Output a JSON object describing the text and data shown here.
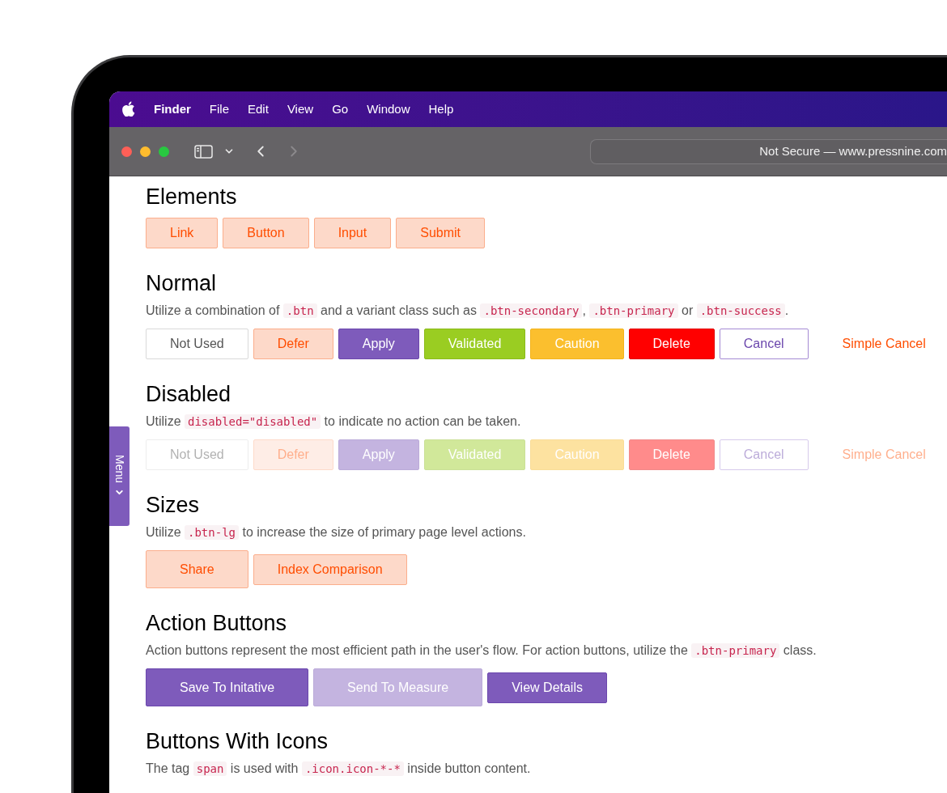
{
  "menu_bar": {
    "items": [
      {
        "label": "Finder",
        "bold": true
      },
      {
        "label": "File",
        "bold": false
      },
      {
        "label": "Edit",
        "bold": false
      },
      {
        "label": "View",
        "bold": false
      },
      {
        "label": "Go",
        "bold": false
      },
      {
        "label": "Window",
        "bold": false
      },
      {
        "label": "Help",
        "bold": false
      }
    ]
  },
  "browser": {
    "address": "Not Secure — www.pressnine.com"
  },
  "side_tab": {
    "label": "Menu"
  },
  "sections": [
    {
      "heading": "Elements",
      "buttons": [
        {
          "label": "Link",
          "kind": "secondary",
          "large": false,
          "disabled": false
        },
        {
          "label": "Button",
          "kind": "secondary",
          "large": false,
          "disabled": false
        },
        {
          "label": "Input",
          "kind": "secondary",
          "large": false,
          "disabled": false
        },
        {
          "label": "Submit",
          "kind": "secondary",
          "large": false,
          "disabled": false
        }
      ]
    },
    {
      "heading": "Normal",
      "description": [
        {
          "text": "Utilize a combination of ",
          "code": false
        },
        {
          "text": ".btn",
          "code": true
        },
        {
          "text": " and a variant class such as ",
          "code": false
        },
        {
          "text": ".btn-secondary",
          "code": true
        },
        {
          "text": ", ",
          "code": false
        },
        {
          "text": ".btn-primary",
          "code": true
        },
        {
          "text": " or ",
          "code": false
        },
        {
          "text": ".btn-success",
          "code": true
        },
        {
          "text": ".",
          "code": false
        }
      ],
      "buttons": [
        {
          "label": "Not Used",
          "kind": "default",
          "large": false,
          "disabled": false
        },
        {
          "label": "Defer",
          "kind": "secondary",
          "large": false,
          "disabled": false
        },
        {
          "label": "Apply",
          "kind": "primary",
          "large": false,
          "disabled": false
        },
        {
          "label": "Validated",
          "kind": "success",
          "large": false,
          "disabled": false
        },
        {
          "label": "Caution",
          "kind": "warning",
          "large": false,
          "disabled": false
        },
        {
          "label": "Delete",
          "kind": "danger",
          "large": false,
          "disabled": false
        },
        {
          "label": "Cancel",
          "kind": "outline",
          "large": false,
          "disabled": false
        },
        {
          "label": "Simple Cancel",
          "kind": "link",
          "large": false,
          "disabled": false
        }
      ]
    },
    {
      "heading": "Disabled",
      "description": [
        {
          "text": "Utilize ",
          "code": false
        },
        {
          "text": "disabled=\"disabled\"",
          "code": true
        },
        {
          "text": " to indicate no action can be taken.",
          "code": false
        }
      ],
      "buttons": [
        {
          "label": "Not Used",
          "kind": "default",
          "large": false,
          "disabled": true
        },
        {
          "label": "Defer",
          "kind": "secondary",
          "large": false,
          "disabled": true
        },
        {
          "label": "Apply",
          "kind": "primary",
          "large": false,
          "disabled": true
        },
        {
          "label": "Validated",
          "kind": "success",
          "large": false,
          "disabled": true
        },
        {
          "label": "Caution",
          "kind": "warning",
          "large": false,
          "disabled": true
        },
        {
          "label": "Delete",
          "kind": "danger",
          "large": false,
          "disabled": true
        },
        {
          "label": "Cancel",
          "kind": "outline",
          "large": false,
          "disabled": true
        },
        {
          "label": "Simple Cancel",
          "kind": "link",
          "large": false,
          "disabled": true
        }
      ]
    },
    {
      "heading": "Sizes",
      "description": [
        {
          "text": "Utilize ",
          "code": false
        },
        {
          "text": ".btn-lg",
          "code": true
        },
        {
          "text": " to increase the size of primary page level actions.",
          "code": false
        }
      ],
      "buttons": [
        {
          "label": "Share",
          "kind": "secondary",
          "large": true,
          "disabled": false
        },
        {
          "label": "Index Comparison",
          "kind": "secondary",
          "large": false,
          "disabled": false
        }
      ]
    },
    {
      "heading": "Action Buttons",
      "description": [
        {
          "text": "Action buttons represent the most efficient path in the user's flow. For action buttons, utilize the ",
          "code": false
        },
        {
          "text": ".btn-primary",
          "code": true
        },
        {
          "text": " class.",
          "code": false
        }
      ],
      "buttons": [
        {
          "label": "Save To Initative",
          "kind": "primary",
          "large": true,
          "disabled": false
        },
        {
          "label": "Send To Measure",
          "kind": "primary",
          "large": true,
          "disabled": true
        },
        {
          "label": "View Details",
          "kind": "primary",
          "large": false,
          "disabled": false
        }
      ]
    },
    {
      "heading": "Buttons With Icons",
      "description": [
        {
          "text": "The tag ",
          "code": false
        },
        {
          "text": "span",
          "code": true
        },
        {
          "text": " is used with ",
          "code": false
        },
        {
          "text": ".icon.icon-*-*",
          "code": true
        },
        {
          "text": " inside button content.",
          "code": false
        }
      ]
    }
  ]
}
